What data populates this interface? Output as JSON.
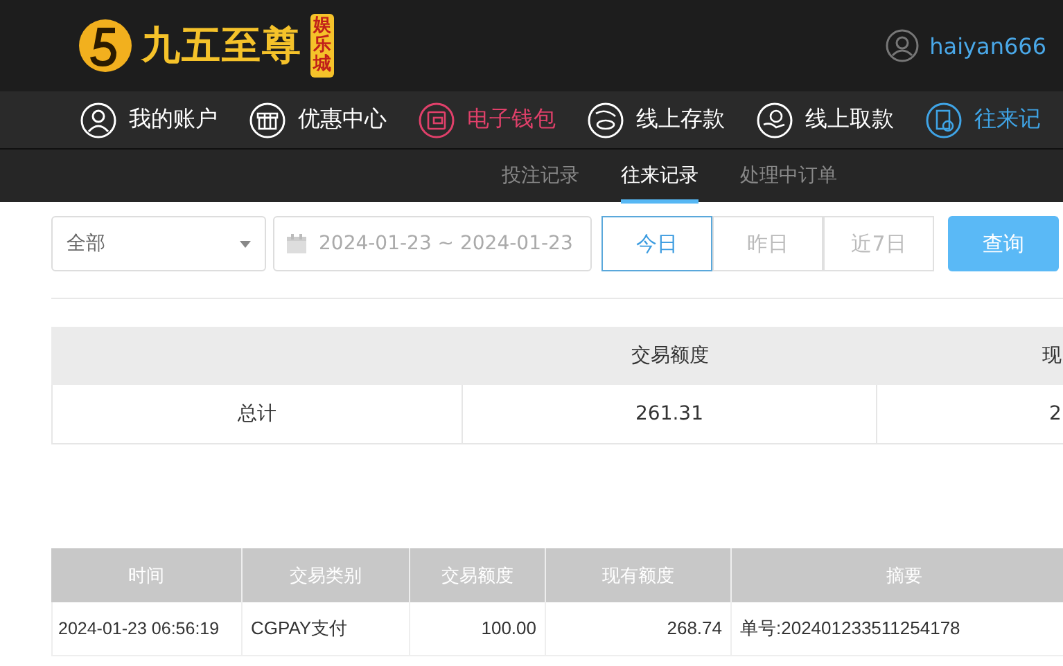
{
  "header": {
    "brand": "九五至尊",
    "brand_badge": "娱乐城",
    "username": "haiyan666"
  },
  "nav": [
    {
      "label": "我的账户",
      "selected": false,
      "hot": false
    },
    {
      "label": "优惠中心",
      "selected": false,
      "hot": false
    },
    {
      "label": "电子钱包",
      "selected": false,
      "hot": true
    },
    {
      "label": "线上存款",
      "selected": false,
      "hot": false
    },
    {
      "label": "线上取款",
      "selected": false,
      "hot": false
    },
    {
      "label": "往来记",
      "selected": true,
      "hot": false
    }
  ],
  "subnav": [
    {
      "label": "投注记录",
      "selected": false
    },
    {
      "label": "往来记录",
      "selected": true
    },
    {
      "label": "处理中订单",
      "selected": false
    }
  ],
  "filters": {
    "type_select": "全部",
    "date_range": "2024-01-23 ~ 2024-01-23",
    "quick_ranges": [
      {
        "label": "今日",
        "selected": true
      },
      {
        "label": "昨日",
        "selected": false
      },
      {
        "label": "近7日",
        "selected": false
      }
    ],
    "query_button": "查询"
  },
  "summary": {
    "columns": [
      "交易额度",
      "现"
    ],
    "row": [
      "总计",
      "261.31",
      "2"
    ]
  },
  "table": {
    "columns": [
      "时间",
      "交易类别",
      "交易额度",
      "现有额度",
      "摘要"
    ],
    "rows": [
      [
        "2024-01-23 06:56:19",
        "CGPAY支付",
        "100.00",
        "268.74",
        "单号:202401233511254178"
      ]
    ]
  }
}
